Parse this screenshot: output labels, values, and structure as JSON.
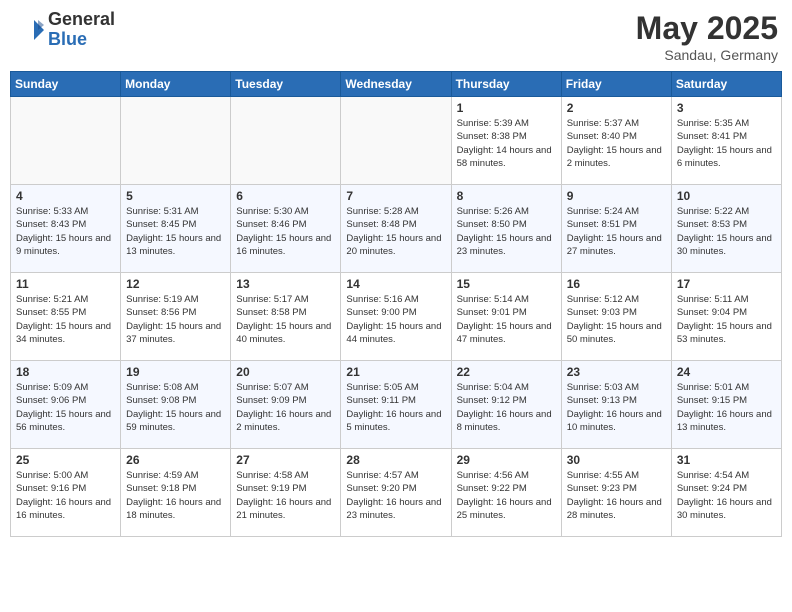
{
  "header": {
    "logo_general": "General",
    "logo_blue": "Blue",
    "month_year": "May 2025",
    "location": "Sandau, Germany"
  },
  "weekdays": [
    "Sunday",
    "Monday",
    "Tuesday",
    "Wednesday",
    "Thursday",
    "Friday",
    "Saturday"
  ],
  "weeks": [
    [
      {
        "day": "",
        "empty": true
      },
      {
        "day": "",
        "empty": true
      },
      {
        "day": "",
        "empty": true
      },
      {
        "day": "",
        "empty": true
      },
      {
        "day": "1",
        "sunrise": "5:39 AM",
        "sunset": "8:38 PM",
        "daylight": "14 hours and 58 minutes."
      },
      {
        "day": "2",
        "sunrise": "5:37 AM",
        "sunset": "8:40 PM",
        "daylight": "15 hours and 2 minutes."
      },
      {
        "day": "3",
        "sunrise": "5:35 AM",
        "sunset": "8:41 PM",
        "daylight": "15 hours and 6 minutes."
      }
    ],
    [
      {
        "day": "4",
        "sunrise": "5:33 AM",
        "sunset": "8:43 PM",
        "daylight": "15 hours and 9 minutes."
      },
      {
        "day": "5",
        "sunrise": "5:31 AM",
        "sunset": "8:45 PM",
        "daylight": "15 hours and 13 minutes."
      },
      {
        "day": "6",
        "sunrise": "5:30 AM",
        "sunset": "8:46 PM",
        "daylight": "15 hours and 16 minutes."
      },
      {
        "day": "7",
        "sunrise": "5:28 AM",
        "sunset": "8:48 PM",
        "daylight": "15 hours and 20 minutes."
      },
      {
        "day": "8",
        "sunrise": "5:26 AM",
        "sunset": "8:50 PM",
        "daylight": "15 hours and 23 minutes."
      },
      {
        "day": "9",
        "sunrise": "5:24 AM",
        "sunset": "8:51 PM",
        "daylight": "15 hours and 27 minutes."
      },
      {
        "day": "10",
        "sunrise": "5:22 AM",
        "sunset": "8:53 PM",
        "daylight": "15 hours and 30 minutes."
      }
    ],
    [
      {
        "day": "11",
        "sunrise": "5:21 AM",
        "sunset": "8:55 PM",
        "daylight": "15 hours and 34 minutes."
      },
      {
        "day": "12",
        "sunrise": "5:19 AM",
        "sunset": "8:56 PM",
        "daylight": "15 hours and 37 minutes."
      },
      {
        "day": "13",
        "sunrise": "5:17 AM",
        "sunset": "8:58 PM",
        "daylight": "15 hours and 40 minutes."
      },
      {
        "day": "14",
        "sunrise": "5:16 AM",
        "sunset": "9:00 PM",
        "daylight": "15 hours and 44 minutes."
      },
      {
        "day": "15",
        "sunrise": "5:14 AM",
        "sunset": "9:01 PM",
        "daylight": "15 hours and 47 minutes."
      },
      {
        "day": "16",
        "sunrise": "5:12 AM",
        "sunset": "9:03 PM",
        "daylight": "15 hours and 50 minutes."
      },
      {
        "day": "17",
        "sunrise": "5:11 AM",
        "sunset": "9:04 PM",
        "daylight": "15 hours and 53 minutes."
      }
    ],
    [
      {
        "day": "18",
        "sunrise": "5:09 AM",
        "sunset": "9:06 PM",
        "daylight": "15 hours and 56 minutes."
      },
      {
        "day": "19",
        "sunrise": "5:08 AM",
        "sunset": "9:08 PM",
        "daylight": "15 hours and 59 minutes."
      },
      {
        "day": "20",
        "sunrise": "5:07 AM",
        "sunset": "9:09 PM",
        "daylight": "16 hours and 2 minutes."
      },
      {
        "day": "21",
        "sunrise": "5:05 AM",
        "sunset": "9:11 PM",
        "daylight": "16 hours and 5 minutes."
      },
      {
        "day": "22",
        "sunrise": "5:04 AM",
        "sunset": "9:12 PM",
        "daylight": "16 hours and 8 minutes."
      },
      {
        "day": "23",
        "sunrise": "5:03 AM",
        "sunset": "9:13 PM",
        "daylight": "16 hours and 10 minutes."
      },
      {
        "day": "24",
        "sunrise": "5:01 AM",
        "sunset": "9:15 PM",
        "daylight": "16 hours and 13 minutes."
      }
    ],
    [
      {
        "day": "25",
        "sunrise": "5:00 AM",
        "sunset": "9:16 PM",
        "daylight": "16 hours and 16 minutes."
      },
      {
        "day": "26",
        "sunrise": "4:59 AM",
        "sunset": "9:18 PM",
        "daylight": "16 hours and 18 minutes."
      },
      {
        "day": "27",
        "sunrise": "4:58 AM",
        "sunset": "9:19 PM",
        "daylight": "16 hours and 21 minutes."
      },
      {
        "day": "28",
        "sunrise": "4:57 AM",
        "sunset": "9:20 PM",
        "daylight": "16 hours and 23 minutes."
      },
      {
        "day": "29",
        "sunrise": "4:56 AM",
        "sunset": "9:22 PM",
        "daylight": "16 hours and 25 minutes."
      },
      {
        "day": "30",
        "sunrise": "4:55 AM",
        "sunset": "9:23 PM",
        "daylight": "16 hours and 28 minutes."
      },
      {
        "day": "31",
        "sunrise": "4:54 AM",
        "sunset": "9:24 PM",
        "daylight": "16 hours and 30 minutes."
      }
    ]
  ],
  "labels": {
    "sunrise_prefix": "Sunrise: ",
    "sunset_prefix": "Sunset: ",
    "daylight_prefix": "Daylight: "
  }
}
